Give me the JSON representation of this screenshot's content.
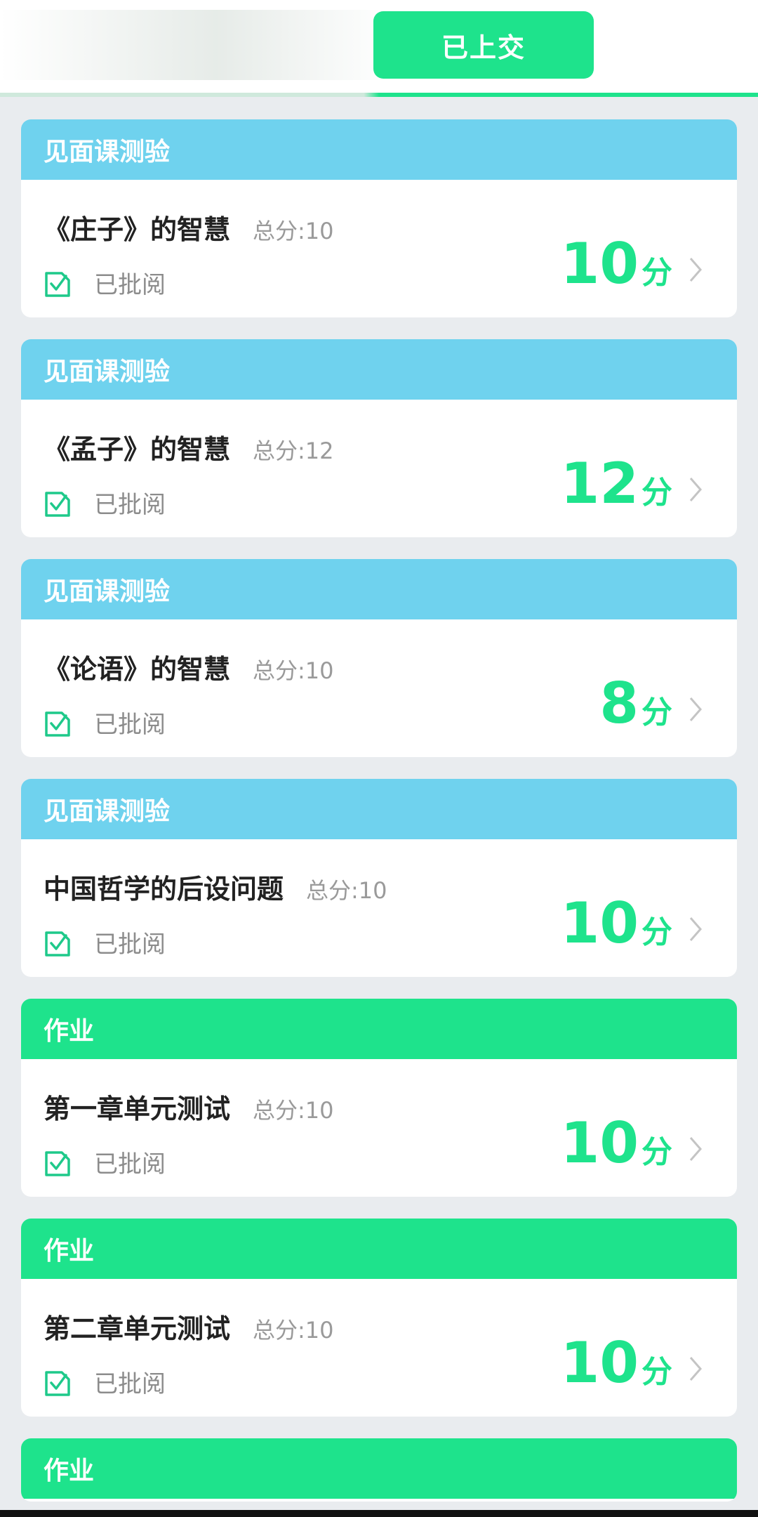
{
  "header": {
    "active_tab_label": "已上交"
  },
  "cards": [
    {
      "category": "见面课测验",
      "category_color": "#6fd2ee",
      "title": "《庄子》的智慧",
      "total": "总分:10",
      "status": "已批阅",
      "score": "10",
      "score_unit": "分"
    },
    {
      "category": "见面课测验",
      "category_color": "#6fd2ee",
      "title": "《孟子》的智慧",
      "total": "总分:12",
      "status": "已批阅",
      "score": "12",
      "score_unit": "分"
    },
    {
      "category": "见面课测验",
      "category_color": "#6fd2ee",
      "title": "《论语》的智慧",
      "total": "总分:10",
      "status": "已批阅",
      "score": "8",
      "score_unit": "分"
    },
    {
      "category": "见面课测验",
      "category_color": "#6fd2ee",
      "title": "中国哲学的后设问题",
      "total": "总分:10",
      "status": "已批阅",
      "score": "10",
      "score_unit": "分"
    },
    {
      "category": "作业",
      "category_color": "#1ee38c",
      "title": "第一章单元测试",
      "total": "总分:10",
      "status": "已批阅",
      "score": "10",
      "score_unit": "分"
    },
    {
      "category": "作业",
      "category_color": "#1ee38c",
      "title": "第二章单元测试",
      "total": "总分:10",
      "status": "已批阅",
      "score": "10",
      "score_unit": "分"
    }
  ],
  "partial_card": {
    "category": "作业"
  },
  "colors": {
    "accent_green": "#1ee38c",
    "header_blue": "#6fd2ee",
    "background": "#e9ecef"
  },
  "icons": {
    "status": "reviewed-check-icon",
    "arrow": "chevron-right-icon"
  }
}
